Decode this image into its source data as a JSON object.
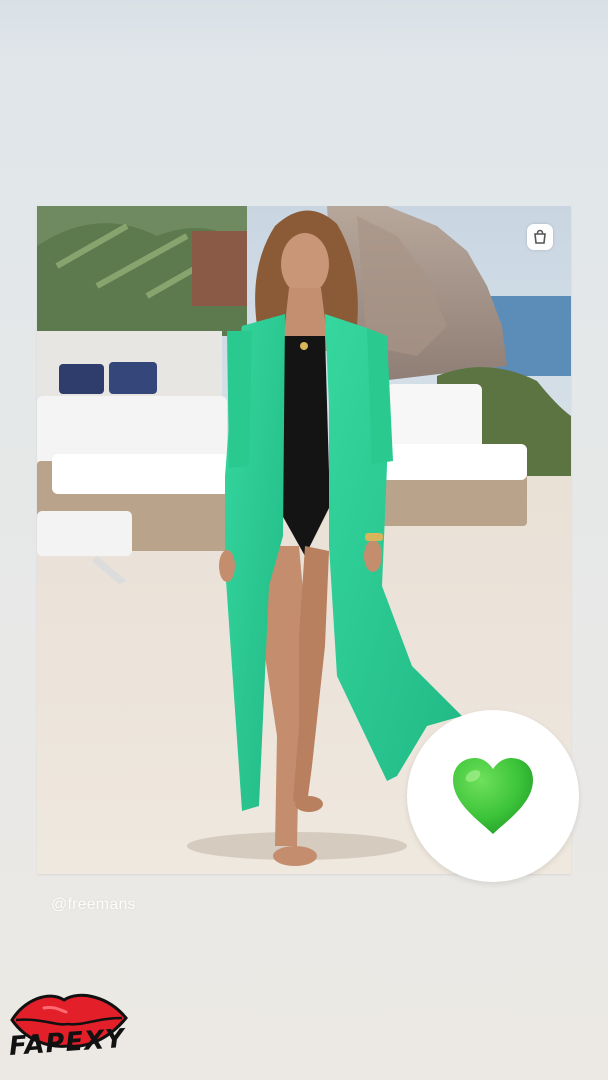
{
  "story": {
    "mention": "@freemans",
    "shop_icon": "shopping-bag-icon",
    "reaction_icon": "green-heart-icon"
  },
  "watermark": {
    "logo_icon": "lips-icon",
    "brand": "FAPEXY"
  },
  "colors": {
    "dress": "#2fcf95",
    "heart": "#3cc43a",
    "lips": "#e31f2a"
  }
}
